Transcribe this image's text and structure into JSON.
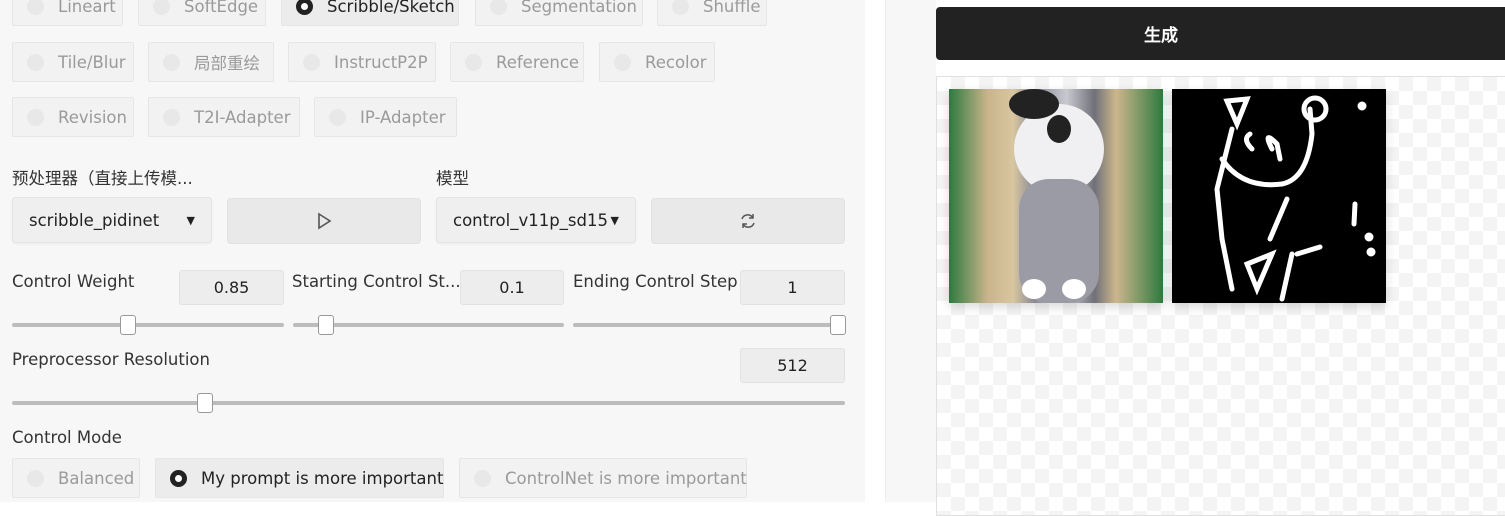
{
  "control_types": [
    {
      "label": "Lineart",
      "selected": false
    },
    {
      "label": "SoftEdge",
      "selected": false
    },
    {
      "label": "Scribble/Sketch",
      "selected": true
    },
    {
      "label": "Segmentation",
      "selected": false
    },
    {
      "label": "Shuffle",
      "selected": false
    },
    {
      "label": "Tile/Blur",
      "selected": false
    },
    {
      "label": "局部重绘",
      "selected": false
    },
    {
      "label": "InstructP2P",
      "selected": false
    },
    {
      "label": "Reference",
      "selected": false
    },
    {
      "label": "Recolor",
      "selected": false
    },
    {
      "label": "Revision",
      "selected": false
    },
    {
      "label": "T2I-Adapter",
      "selected": false
    },
    {
      "label": "IP-Adapter",
      "selected": false
    }
  ],
  "preprocessor": {
    "label": "预处理器（直接上传模...",
    "value": "scribble_pidinet",
    "run_icon": "play-icon"
  },
  "model": {
    "label": "模型",
    "value": "control_v11p_sd15",
    "refresh_icon": "refresh-icon"
  },
  "sliders": {
    "control_weight": {
      "label": "Control Weight",
      "value": "0.85",
      "min": 0,
      "max": 2
    },
    "starting_step": {
      "label": "Starting Control St...",
      "value": "0.1",
      "min": 0,
      "max": 1
    },
    "ending_step": {
      "label": "Ending Control Step",
      "value": "1",
      "min": 0,
      "max": 1
    },
    "resolution": {
      "label": "Preprocessor Resolution",
      "value": "512",
      "min": 64,
      "max": 2048
    }
  },
  "control_mode": {
    "label": "Control Mode",
    "options": [
      {
        "label": "Balanced",
        "selected": false
      },
      {
        "label": "My prompt is more important",
        "selected": true
      },
      {
        "label": "ControlNet is more important",
        "selected": false
      }
    ]
  },
  "generate": {
    "label": "生成"
  },
  "accent": "#222222"
}
